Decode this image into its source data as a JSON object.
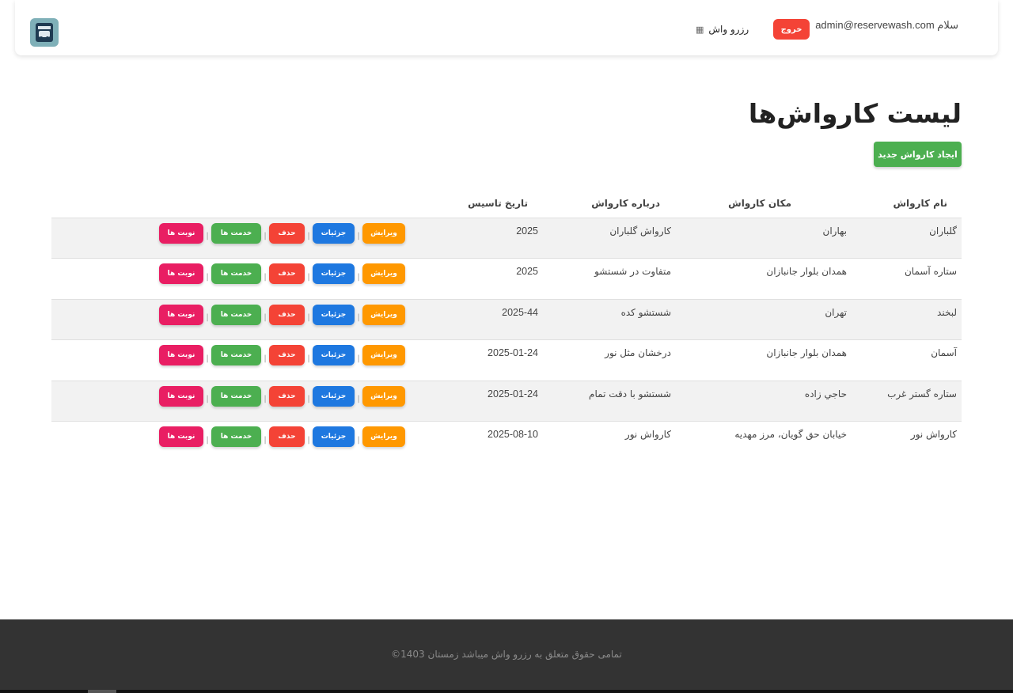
{
  "header": {
    "greeting": "سلام admin@reservewash.com",
    "logout_label": "خروج",
    "brand_label": "رزرو واش",
    "brand_icon": "grid-icon",
    "logo_icon": "carwash-logo"
  },
  "page": {
    "title": "لیست کارواش‌ها",
    "create_label": "ایجاد کارواش جدید"
  },
  "table": {
    "columns": [
      "نام کارواش",
      "مکان کارواش",
      "درباره کارواش",
      "تاریخ تاسیس",
      ""
    ],
    "actions": {
      "edit": "ویرایش",
      "details": "جزئیات",
      "delete": "حذف",
      "services": "خدمت ها",
      "appointments": "نوبت ها",
      "separator": "|"
    },
    "rows": [
      {
        "name": "گلباران",
        "location": "بهاران",
        "about": "کارواش گلباران",
        "date": "2025"
      },
      {
        "name": "ستاره آسمان",
        "location": "همدان بلوار جانبازان",
        "about": "متفاوت در شستشو",
        "date": "2025"
      },
      {
        "name": "لبخند",
        "location": "تهران",
        "about": "شستشو کده",
        "date": "2025-44"
      },
      {
        "name": "آسمان",
        "location": "همدان بلوار جانبازان",
        "about": "درخشان مثل نور",
        "date": "2025-01-24"
      },
      {
        "name": "ستاره گستر غرب",
        "location": "حاجي زاده",
        "about": "شستشو با دقت تمام",
        "date": "2025-01-24"
      },
      {
        "name": "کارواش نور",
        "location": "خیابان حق گویان، مرز مهدیه",
        "about": "کارواش نور",
        "date": "2025-08-10"
      }
    ]
  },
  "footer": {
    "copyright": "تمامی حقوق متعلق به رزرو واش میباشد زمستان 1403©"
  },
  "colors": {
    "edit": "#ff9800",
    "details": "#1e78e0",
    "delete": "#f44336",
    "services": "#4caf50",
    "appointments": "#e91e63",
    "create": "#4caf50",
    "footer_bg": "#333333"
  }
}
